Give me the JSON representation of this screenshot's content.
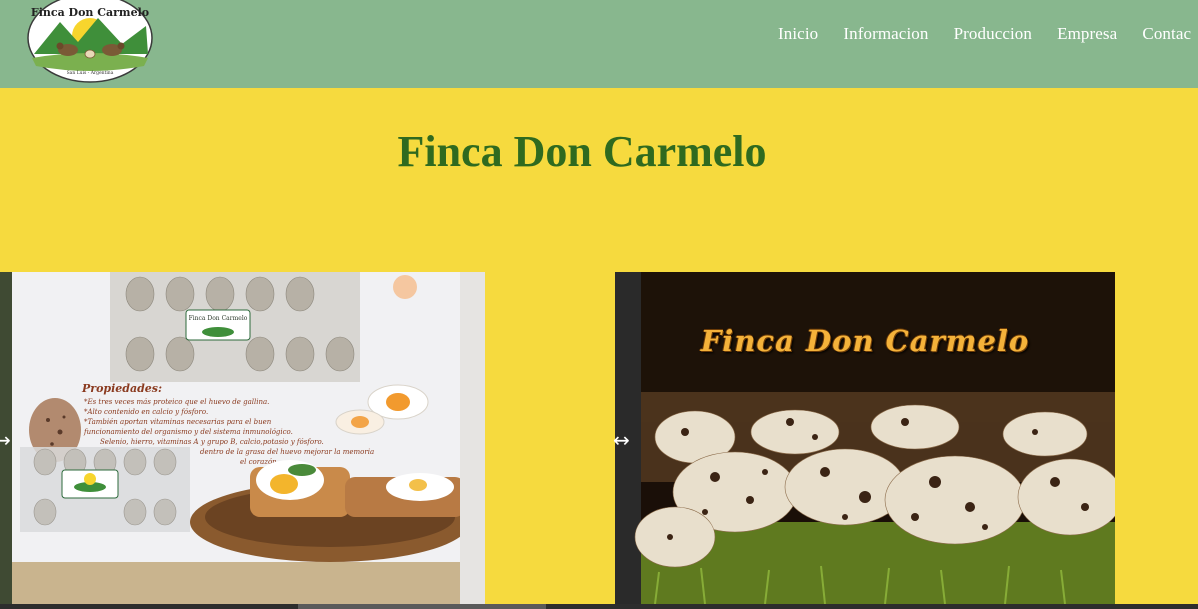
{
  "nav": {
    "logo": {
      "text_top": "Finca Don Carmelo",
      "text_bottom": "San Luis - Argentina"
    },
    "links": [
      "Inicio",
      "Informacion",
      "Produccion",
      "Empresa",
      "Contac"
    ]
  },
  "hero": {
    "title": "Finca Don Carmelo"
  },
  "slides": [
    {
      "box_label": "Finca Don Carmelo",
      "props_title": "Propiedades:",
      "props_lines": [
        "*Es tres veces más proteico que el huevo de gallina.",
        "*Alto contenido en calcio y fósforo.",
        "*También aportan vitaminas necesarias para el buen",
        "funcionamiento del organismo y del sistema inmunológico.",
        "Selenio, hierro, vitaminas A y grupo B, calcio,potasio y fósforo.",
        "dentro de la grasa del huevo mejorar la memoria",
        "el corazón."
      ]
    },
    {
      "overlay_title": "Finca Don Carmelo"
    }
  ],
  "colors": {
    "page_bg": "#f6da3e",
    "navbar_bg": "#88b78e",
    "title": "#2f6a1f",
    "nav_text": "#ffffff"
  },
  "icons": {
    "slide_arrow": "left-right-arrow-icon"
  }
}
